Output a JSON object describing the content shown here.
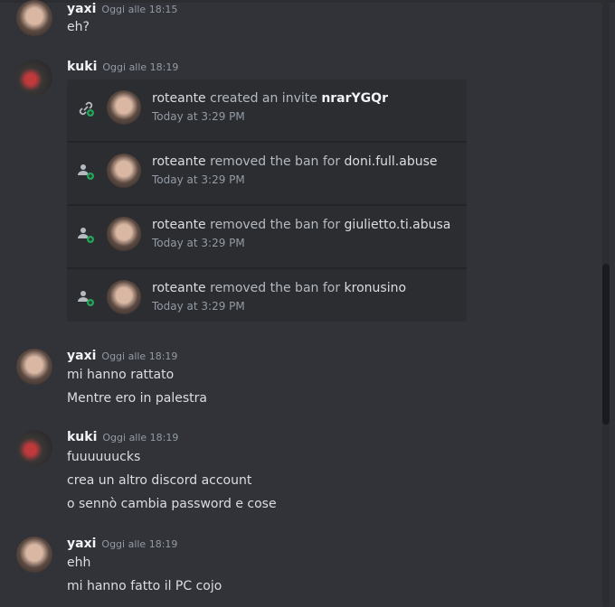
{
  "messages": [
    {
      "author": "yaxi",
      "time": "Oggi alle 18:15",
      "lines": [
        "eh?"
      ]
    },
    {
      "author": "kuki",
      "time": "Oggi alle 18:19",
      "embed": [
        {
          "actor": "roteante",
          "action": "created an invite",
          "target": "nrarYGQr",
          "time": "Today at 3:29 PM",
          "icon": "invite-link-icon"
        },
        {
          "actor": "roteante",
          "action": "removed the ban for",
          "target": "doni.full.abuse",
          "time": "Today at 3:29 PM",
          "icon": "member-add-icon"
        },
        {
          "actor": "roteante",
          "action": "removed the ban for",
          "target": "giulietto.ti.abusa",
          "time": "Today at 3:29 PM",
          "icon": "member-add-icon"
        },
        {
          "actor": "roteante",
          "action": "removed the ban for",
          "target": "kronusino",
          "time": "Today at 3:29 PM",
          "icon": "member-add-icon"
        }
      ]
    },
    {
      "author": "yaxi",
      "time": "Oggi alle 18:19",
      "lines": [
        "mi hanno rattato",
        "Mentre ero in palestra"
      ]
    },
    {
      "author": "kuki",
      "time": "Oggi alle 18:19",
      "lines": [
        "fuuuuuucks",
        "crea un altro discord account",
        "o sennò cambia password e cose"
      ]
    },
    {
      "author": "yaxi",
      "time": "Oggi alle 18:19",
      "lines": [
        "ehh",
        "mi hanno fatto il PC cojo"
      ]
    }
  ],
  "colors": {
    "background": "#313338",
    "embed": "#2b2d31",
    "accent_green": "#23a55a"
  }
}
